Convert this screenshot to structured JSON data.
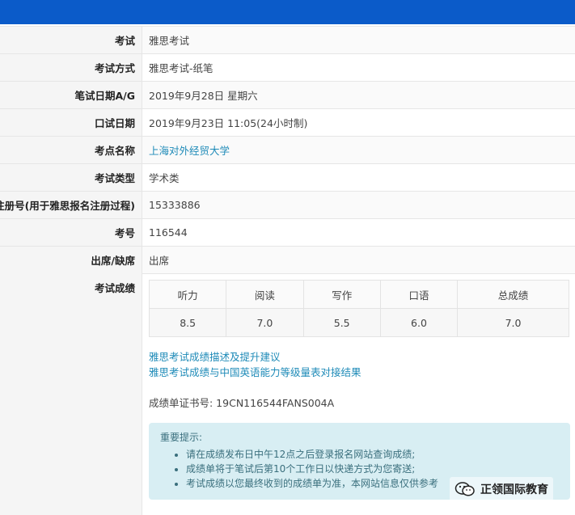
{
  "info_rows": [
    {
      "label": "考试",
      "value": "雅思考试"
    },
    {
      "label": "考试方式",
      "value": "雅思考试-纸笔"
    },
    {
      "label": "笔试日期A/G",
      "value": "2019年9月28日 星期六"
    },
    {
      "label": "口试日期",
      "value": "2019年9月23日 11:05(24小时制)"
    },
    {
      "label": "考点名称",
      "value": "上海对外经贸大学"
    },
    {
      "label": "考试类型",
      "value": "学术类"
    },
    {
      "label": "注册号(用于雅思报名注册过程)",
      "value": "15333886"
    },
    {
      "label": "考号",
      "value": "116544"
    },
    {
      "label": "出席/缺席",
      "value": "出席"
    }
  ],
  "scores": {
    "label": "考试成绩",
    "headers": [
      "听力",
      "阅读",
      "写作",
      "口语",
      "总成绩"
    ],
    "values": [
      "8.5",
      "7.0",
      "5.5",
      "6.0",
      "7.0"
    ]
  },
  "links": [
    "雅思考试成绩描述及提升建议",
    "雅思考试成绩与中国英语能力等级量表对接结果"
  ],
  "certificate": "成绩单证书号: 19CN116544FANS004A",
  "notice": {
    "title": "重要提示:",
    "items": [
      "请在成绩发布日中午12点之后登录报名网站查询成绩;",
      "成绩单将于笔试后第10个工作日以快递方式为您寄送;",
      "考试成绩以您最终收到的成绩单为准，本网站信息仅供参考"
    ]
  },
  "watermark": "正领国际教育",
  "colors": {
    "topbar": "#0b5bc9",
    "link": "#1f8bb8",
    "notice_bg": "#d8eef3"
  }
}
